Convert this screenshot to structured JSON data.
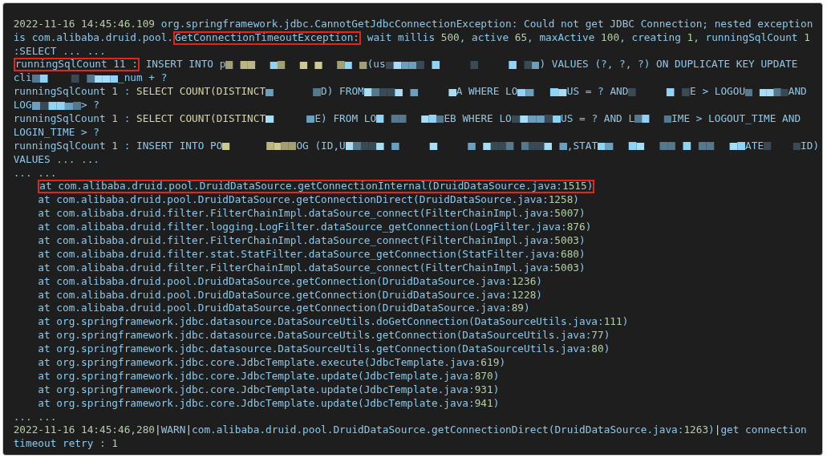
{
  "log_panel": {
    "rows": [
      {
        "kind": "line",
        "parts": [
          {
            "kind": "text",
            "highlighted": false,
            "tokens": [
              {
                "kind": "number",
                "text": "2022-11-16 14:45:46.109"
              },
              {
                "kind": "plain",
                "text": " org.springframework.jdbc.CannotGetJdbcConnectionException: Could not get JDBC Connection; nested exception"
              }
            ]
          }
        ]
      },
      {
        "kind": "line",
        "parts": [
          {
            "kind": "text",
            "highlighted": false,
            "tokens": [
              {
                "kind": "plain",
                "text": "is com.alibaba.druid.pool."
              }
            ]
          },
          {
            "kind": "text",
            "highlighted": true,
            "tokens": [
              {
                "kind": "plain",
                "text": "GetConnectionTimeoutException:"
              }
            ]
          },
          {
            "kind": "text",
            "highlighted": false,
            "tokens": [
              {
                "kind": "plain",
                "text": " wait millis "
              },
              {
                "kind": "number",
                "text": "500"
              },
              {
                "kind": "plain",
                "text": ", active "
              },
              {
                "kind": "number",
                "text": "65"
              },
              {
                "kind": "plain",
                "text": ", maxActive "
              },
              {
                "kind": "number",
                "text": "100"
              },
              {
                "kind": "plain",
                "text": ", creating "
              },
              {
                "kind": "number",
                "text": "1"
              },
              {
                "kind": "plain",
                "text": ", runningSqlCount "
              },
              {
                "kind": "number",
                "text": "1"
              }
            ]
          }
        ]
      },
      {
        "kind": "line",
        "parts": [
          {
            "kind": "text",
            "highlighted": false,
            "tokens": [
              {
                "kind": "plain",
                "text": ":SELECT ... ..."
              }
            ]
          }
        ]
      },
      {
        "kind": "line",
        "parts": [
          {
            "kind": "text",
            "highlighted": true,
            "tokens": [
              {
                "kind": "plain",
                "text": "runningSqlCount 11 :"
              }
            ]
          },
          {
            "kind": "text",
            "highlighted": false,
            "tokens": [
              {
                "kind": "plain",
                "text": " INSERT INTO p"
              }
            ]
          },
          {
            "kind": "redacted",
            "highlighted": false
          },
          {
            "kind": "text",
            "highlighted": false,
            "tokens": [
              {
                "kind": "plain",
                "text": "(us"
              }
            ]
          },
          {
            "kind": "redacted",
            "highlighted": false
          },
          {
            "kind": "text",
            "highlighted": false,
            "tokens": [
              {
                "kind": "plain",
                "text": ") VALUES (?, ?, ?) ON DUPLICATE KEY UPDATE"
              }
            ]
          }
        ]
      },
      {
        "kind": "line",
        "parts": [
          {
            "kind": "text",
            "highlighted": false,
            "tokens": [
              {
                "kind": "plain",
                "text": "cli"
              }
            ]
          },
          {
            "kind": "redacted",
            "highlighted": false
          },
          {
            "kind": "text",
            "highlighted": false,
            "tokens": [
              {
                "kind": "plain",
                "text": "_num + ?"
              }
            ]
          }
        ]
      },
      {
        "kind": "line",
        "parts": [
          {
            "kind": "text",
            "highlighted": false,
            "tokens": [
              {
                "kind": "plain",
                "text": "runningSqlCount "
              },
              {
                "kind": "number",
                "text": "1"
              },
              {
                "kind": "plain",
                "text": " : "
              },
              {
                "kind": "keyword",
                "text": "SELECT COUNT(DISTINCT"
              }
            ]
          },
          {
            "kind": "redacted",
            "highlighted": false
          },
          {
            "kind": "text",
            "highlighted": false,
            "tokens": [
              {
                "kind": "plain",
                "text": "D) FROM"
              }
            ]
          },
          {
            "kind": "redacted",
            "highlighted": false
          },
          {
            "kind": "text",
            "highlighted": false,
            "tokens": [
              {
                "kind": "plain",
                "text": "A WHERE LO"
              }
            ]
          },
          {
            "kind": "redacted",
            "highlighted": false
          },
          {
            "kind": "text",
            "highlighted": false,
            "tokens": [
              {
                "kind": "plain",
                "text": "US = ? AND"
              }
            ]
          },
          {
            "kind": "redacted",
            "highlighted": false
          },
          {
            "kind": "text",
            "highlighted": false,
            "tokens": [
              {
                "kind": "plain",
                "text": "E > LOGOU"
              }
            ]
          },
          {
            "kind": "redacted",
            "highlighted": false
          },
          {
            "kind": "text",
            "highlighted": false,
            "tokens": [
              {
                "kind": "plain",
                "text": "AND"
              }
            ]
          }
        ]
      },
      {
        "kind": "line",
        "parts": [
          {
            "kind": "text",
            "highlighted": false,
            "tokens": [
              {
                "kind": "plain",
                "text": "LOG"
              }
            ]
          },
          {
            "kind": "redacted",
            "highlighted": false
          },
          {
            "kind": "text",
            "highlighted": false,
            "tokens": [
              {
                "kind": "plain",
                "text": "> ?"
              }
            ]
          }
        ]
      },
      {
        "kind": "line",
        "parts": [
          {
            "kind": "text",
            "highlighted": false,
            "tokens": [
              {
                "kind": "plain",
                "text": "runningSqlCount "
              },
              {
                "kind": "number",
                "text": "1"
              },
              {
                "kind": "plain",
                "text": " : "
              },
              {
                "kind": "keyword",
                "text": "SELECT COUNT(DISTINCT"
              }
            ]
          },
          {
            "kind": "redacted",
            "highlighted": false
          },
          {
            "kind": "text",
            "highlighted": false,
            "tokens": [
              {
                "kind": "plain",
                "text": "E) FROM LO"
              }
            ]
          },
          {
            "kind": "redacted",
            "highlighted": false
          },
          {
            "kind": "text",
            "highlighted": false,
            "tokens": [
              {
                "kind": "plain",
                "text": "EB WHERE LO"
              }
            ]
          },
          {
            "kind": "redacted",
            "highlighted": false
          },
          {
            "kind": "text",
            "highlighted": false,
            "tokens": [
              {
                "kind": "plain",
                "text": "US = ? AND L"
              }
            ]
          },
          {
            "kind": "redacted",
            "highlighted": false
          },
          {
            "kind": "text",
            "highlighted": false,
            "tokens": [
              {
                "kind": "plain",
                "text": "IME > LOGOUT_TIME AND"
              }
            ]
          }
        ]
      },
      {
        "kind": "line",
        "parts": [
          {
            "kind": "text",
            "highlighted": false,
            "tokens": [
              {
                "kind": "plain",
                "text": "LOGIN_TIME > ?"
              }
            ]
          }
        ]
      },
      {
        "kind": "line",
        "parts": [
          {
            "kind": "text",
            "highlighted": false,
            "tokens": [
              {
                "kind": "plain",
                "text": "runningSqlCount "
              },
              {
                "kind": "number",
                "text": "1"
              },
              {
                "kind": "plain",
                "text": " : INSERT INTO PO"
              }
            ]
          },
          {
            "kind": "redacted",
            "highlighted": false
          },
          {
            "kind": "text",
            "highlighted": false,
            "tokens": [
              {
                "kind": "plain",
                "text": "OG (ID,U"
              }
            ]
          },
          {
            "kind": "redacted",
            "highlighted": false
          },
          {
            "kind": "text",
            "highlighted": false,
            "tokens": [
              {
                "kind": "plain",
                "text": ",STAT"
              }
            ]
          },
          {
            "kind": "redacted",
            "highlighted": false
          },
          {
            "kind": "text",
            "highlighted": false,
            "tokens": [
              {
                "kind": "plain",
                "text": "ATE"
              }
            ]
          },
          {
            "kind": "redacted",
            "highlighted": false
          },
          {
            "kind": "text",
            "highlighted": false,
            "tokens": [
              {
                "kind": "plain",
                "text": "ID)"
              }
            ]
          }
        ]
      },
      {
        "kind": "line",
        "parts": [
          {
            "kind": "text",
            "highlighted": false,
            "tokens": [
              {
                "kind": "plain",
                "text": "VALUES ... ..."
              }
            ]
          }
        ]
      },
      {
        "kind": "line",
        "parts": [
          {
            "kind": "text",
            "highlighted": false,
            "tokens": [
              {
                "kind": "plain",
                "text": "... ..."
              }
            ]
          }
        ]
      },
      {
        "kind": "frame",
        "parts": [
          {
            "kind": "text",
            "highlighted": true,
            "tokens": [
              {
                "kind": "plain",
                "text": "at com.alibaba.druid.pool.DruidDataSource.getConnectionInternal(DruidDataSource.java:"
              },
              {
                "kind": "number",
                "text": "1515"
              },
              {
                "kind": "plain",
                "text": ")"
              }
            ]
          }
        ]
      },
      {
        "kind": "frame",
        "parts": [
          {
            "kind": "text",
            "highlighted": false,
            "tokens": [
              {
                "kind": "plain",
                "text": "at com.alibaba.druid.pool.DruidDataSource.getConnectionDirect(DruidDataSource.java:"
              },
              {
                "kind": "number",
                "text": "1258"
              },
              {
                "kind": "plain",
                "text": ")"
              }
            ]
          }
        ]
      },
      {
        "kind": "frame",
        "parts": [
          {
            "kind": "text",
            "highlighted": false,
            "tokens": [
              {
                "kind": "plain",
                "text": "at com.alibaba.druid.filter.FilterChainImpl.dataSource_connect(FilterChainImpl.java:"
              },
              {
                "kind": "number",
                "text": "5007"
              },
              {
                "kind": "plain",
                "text": ")"
              }
            ]
          }
        ]
      },
      {
        "kind": "frame",
        "parts": [
          {
            "kind": "text",
            "highlighted": false,
            "tokens": [
              {
                "kind": "plain",
                "text": "at com.alibaba.druid.filter.logging.LogFilter.dataSource_getConnection(LogFilter.java:"
              },
              {
                "kind": "number",
                "text": "876"
              },
              {
                "kind": "plain",
                "text": ")"
              }
            ]
          }
        ]
      },
      {
        "kind": "frame",
        "parts": [
          {
            "kind": "text",
            "highlighted": false,
            "tokens": [
              {
                "kind": "plain",
                "text": "at com.alibaba.druid.filter.FilterChainImpl.dataSource_connect(FilterChainImpl.java:"
              },
              {
                "kind": "number",
                "text": "5003"
              },
              {
                "kind": "plain",
                "text": ")"
              }
            ]
          }
        ]
      },
      {
        "kind": "frame",
        "parts": [
          {
            "kind": "text",
            "highlighted": false,
            "tokens": [
              {
                "kind": "plain",
                "text": "at com.alibaba.druid.filter.stat.StatFilter.dataSource_getConnection(StatFilter.java:"
              },
              {
                "kind": "number",
                "text": "680"
              },
              {
                "kind": "plain",
                "text": ")"
              }
            ]
          }
        ]
      },
      {
        "kind": "frame",
        "parts": [
          {
            "kind": "text",
            "highlighted": false,
            "tokens": [
              {
                "kind": "plain",
                "text": "at com.alibaba.druid.filter.FilterChainImpl.dataSource_connect(FilterChainImpl.java:"
              },
              {
                "kind": "number",
                "text": "5003"
              },
              {
                "kind": "plain",
                "text": ")"
              }
            ]
          }
        ]
      },
      {
        "kind": "frame",
        "parts": [
          {
            "kind": "text",
            "highlighted": false,
            "tokens": [
              {
                "kind": "plain",
                "text": "at com.alibaba.druid.pool.DruidDataSource.getConnection(DruidDataSource.java:"
              },
              {
                "kind": "number",
                "text": "1236"
              },
              {
                "kind": "plain",
                "text": ")"
              }
            ]
          }
        ]
      },
      {
        "kind": "frame",
        "parts": [
          {
            "kind": "text",
            "highlighted": false,
            "tokens": [
              {
                "kind": "plain",
                "text": "at com.alibaba.druid.pool.DruidDataSource.getConnection(DruidDataSource.java:"
              },
              {
                "kind": "number",
                "text": "1228"
              },
              {
                "kind": "plain",
                "text": ")"
              }
            ]
          }
        ]
      },
      {
        "kind": "frame",
        "parts": [
          {
            "kind": "text",
            "highlighted": false,
            "tokens": [
              {
                "kind": "plain",
                "text": "at com.alibaba.druid.pool.DruidDataSource.getConnection(DruidDataSource.java:"
              },
              {
                "kind": "number",
                "text": "89"
              },
              {
                "kind": "plain",
                "text": ")"
              }
            ]
          }
        ]
      },
      {
        "kind": "frame",
        "parts": [
          {
            "kind": "text",
            "highlighted": false,
            "tokens": [
              {
                "kind": "plain",
                "text": "at org.springframework.jdbc.datasource.DataSourceUtils.doGetConnection(DataSourceUtils.java:"
              },
              {
                "kind": "number",
                "text": "111"
              },
              {
                "kind": "plain",
                "text": ")"
              }
            ]
          }
        ]
      },
      {
        "kind": "frame",
        "parts": [
          {
            "kind": "text",
            "highlighted": false,
            "tokens": [
              {
                "kind": "plain",
                "text": "at org.springframework.jdbc.datasource.DataSourceUtils.getConnection(DataSourceUtils.java:"
              },
              {
                "kind": "number",
                "text": "77"
              },
              {
                "kind": "plain",
                "text": ")"
              }
            ]
          }
        ]
      },
      {
        "kind": "frame",
        "parts": [
          {
            "kind": "text",
            "highlighted": false,
            "tokens": [
              {
                "kind": "plain",
                "text": "at org.springframework.jdbc.datasource.DataSourceUtils.getConnection(DataSourceUtils.java:"
              },
              {
                "kind": "number",
                "text": "80"
              },
              {
                "kind": "plain",
                "text": ")"
              }
            ]
          }
        ]
      },
      {
        "kind": "frame",
        "parts": [
          {
            "kind": "text",
            "highlighted": false,
            "tokens": [
              {
                "kind": "plain",
                "text": "at org.springframework.jdbc.core.JdbcTemplate.execute(JdbcTemplate.java:"
              },
              {
                "kind": "number",
                "text": "619"
              },
              {
                "kind": "plain",
                "text": ")"
              }
            ]
          }
        ]
      },
      {
        "kind": "frame",
        "parts": [
          {
            "kind": "text",
            "highlighted": false,
            "tokens": [
              {
                "kind": "plain",
                "text": "at org.springframework.jdbc.core.JdbcTemplate.update(JdbcTemplate.java:"
              },
              {
                "kind": "number",
                "text": "870"
              },
              {
                "kind": "plain",
                "text": ")"
              }
            ]
          }
        ]
      },
      {
        "kind": "frame",
        "parts": [
          {
            "kind": "text",
            "highlighted": false,
            "tokens": [
              {
                "kind": "plain",
                "text": "at org.springframework.jdbc.core.JdbcTemplate.update(JdbcTemplate.java:"
              },
              {
                "kind": "number",
                "text": "931"
              },
              {
                "kind": "plain",
                "text": ")"
              }
            ]
          }
        ]
      },
      {
        "kind": "frame",
        "parts": [
          {
            "kind": "text",
            "highlighted": false,
            "tokens": [
              {
                "kind": "plain",
                "text": "at org.springframework.jdbc.core.JdbcTemplate.update(JdbcTemplate.java:"
              },
              {
                "kind": "number",
                "text": "941"
              },
              {
                "kind": "plain",
                "text": ")"
              }
            ]
          }
        ]
      },
      {
        "kind": "line",
        "parts": [
          {
            "kind": "text",
            "highlighted": false,
            "tokens": [
              {
                "kind": "plain",
                "text": "... ..."
              }
            ]
          }
        ]
      },
      {
        "kind": "line",
        "parts": [
          {
            "kind": "text",
            "highlighted": false,
            "tokens": [
              {
                "kind": "number",
                "text": "2022-11-16 14:45:46,280"
              },
              {
                "kind": "separator",
                "text": "|"
              },
              {
                "kind": "plain",
                "text": "WARN"
              },
              {
                "kind": "separator",
                "text": "|"
              },
              {
                "kind": "plain",
                "text": "com.alibaba.druid.pool.DruidDataSource.getConnectionDirect(DruidDataSource.java:"
              },
              {
                "kind": "number",
                "text": "1263"
              },
              {
                "kind": "plain",
                "text": ")"
              },
              {
                "kind": "separator",
                "text": "|"
              },
              {
                "kind": "plain",
                "text": "get connection"
              }
            ]
          }
        ]
      },
      {
        "kind": "line",
        "parts": [
          {
            "kind": "text",
            "highlighted": false,
            "tokens": [
              {
                "kind": "plain",
                "text": "timeout retry : "
              },
              {
                "kind": "number",
                "text": "1"
              }
            ]
          }
        ]
      }
    ]
  }
}
